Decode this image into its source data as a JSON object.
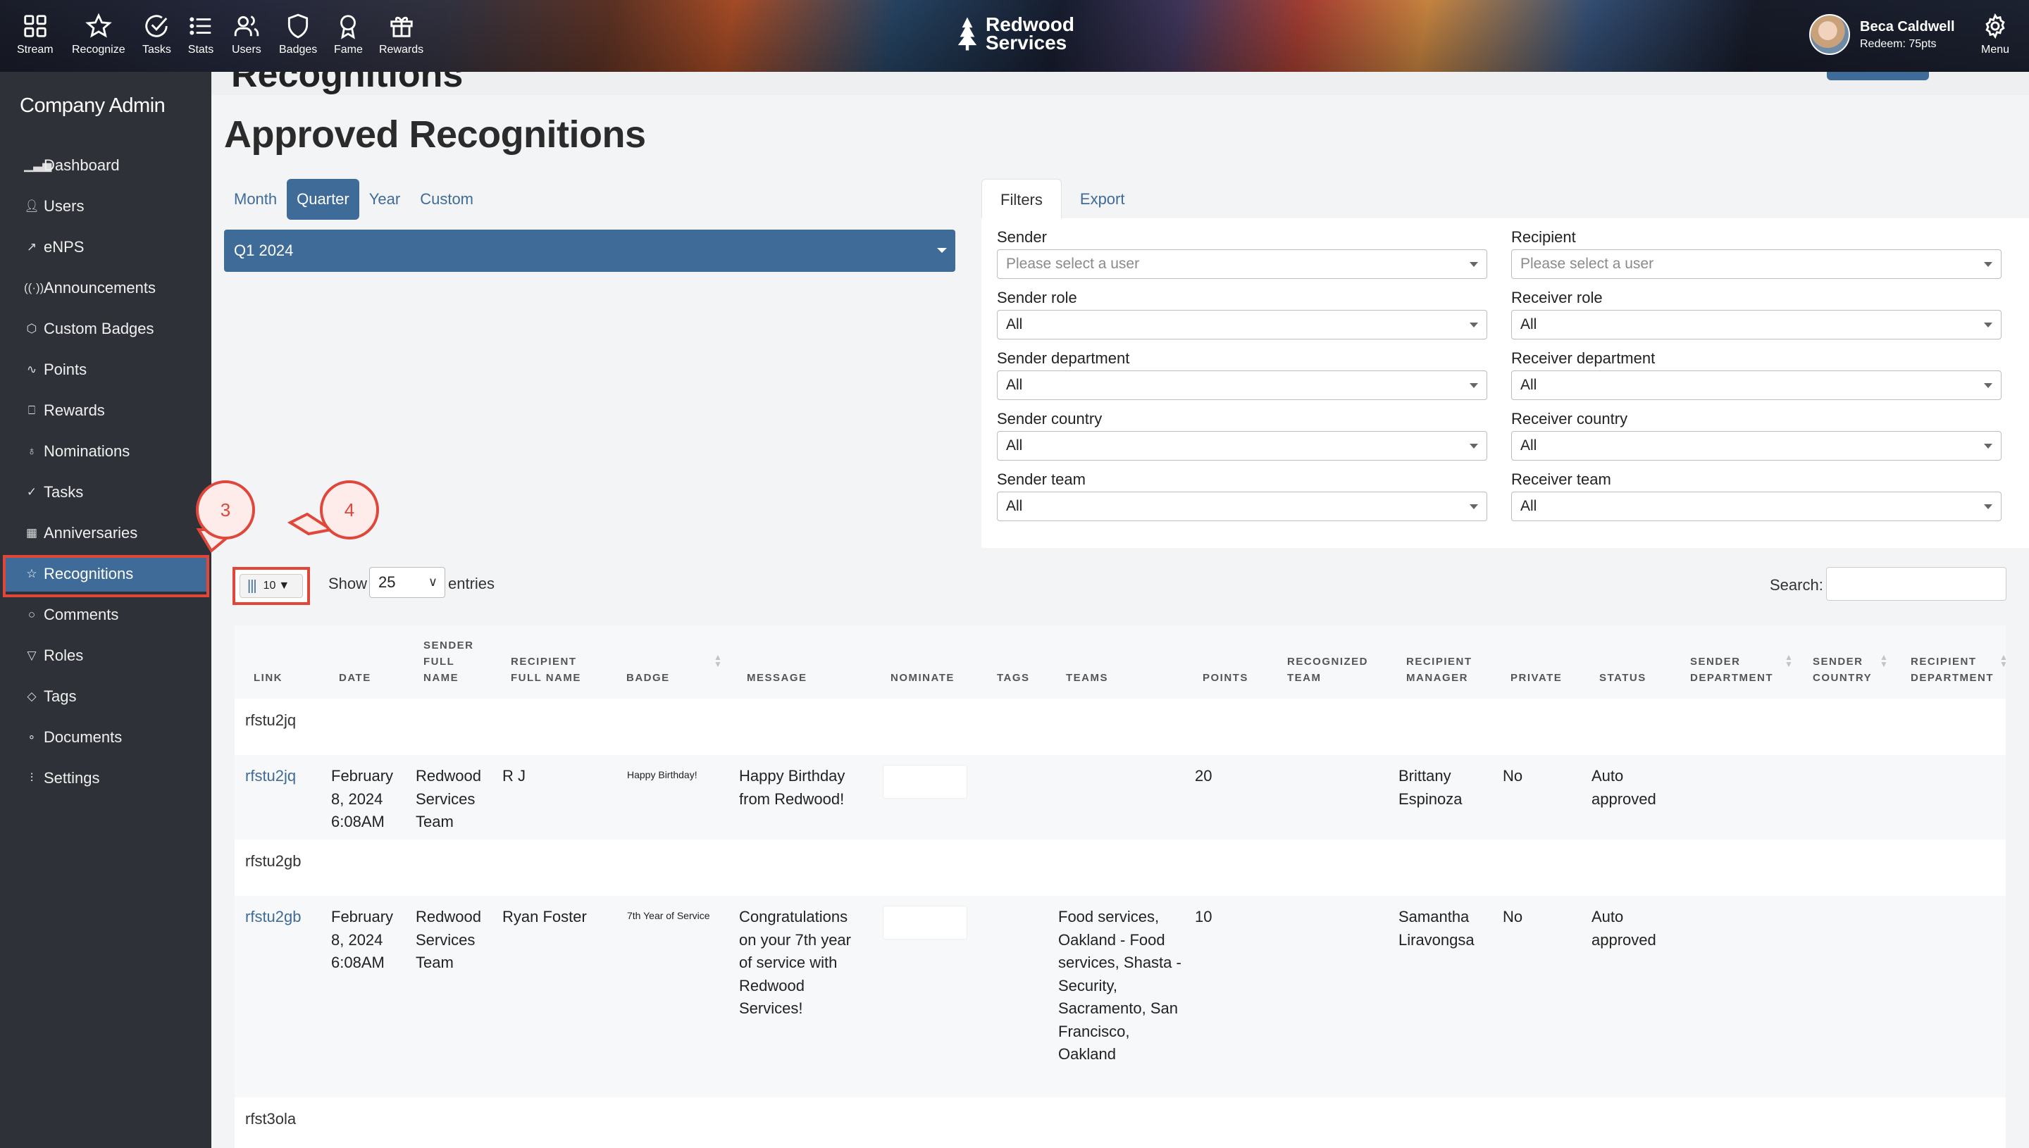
{
  "topnav": {
    "items": [
      {
        "label": "Stream",
        "icon": "grid-icon"
      },
      {
        "label": "Recognize",
        "icon": "star-icon"
      },
      {
        "label": "Tasks",
        "icon": "check-circle-icon"
      },
      {
        "label": "Stats",
        "icon": "list-icon"
      },
      {
        "label": "Users",
        "icon": "users-icon"
      },
      {
        "label": "Badges",
        "icon": "shield-icon"
      },
      {
        "label": "Fame",
        "icon": "award-icon"
      },
      {
        "label": "Rewards",
        "icon": "gift-icon"
      }
    ],
    "brand_line1": "Redwood",
    "brand_line2": "Services",
    "user_name": "Beca Caldwell",
    "user_sub": "Redeem: 75pts",
    "menu_label": "Menu"
  },
  "sidebar": {
    "title": "Company Admin",
    "items": [
      {
        "label": "Dashboard",
        "icon": "bar-chart-icon"
      },
      {
        "label": "Users",
        "icon": "user-icon"
      },
      {
        "label": "eNPS",
        "icon": "trend-icon"
      },
      {
        "label": "Announcements",
        "icon": "broadcast-icon"
      },
      {
        "label": "Custom Badges",
        "icon": "shield-icon"
      },
      {
        "label": "Points",
        "icon": "pulse-icon"
      },
      {
        "label": "Rewards",
        "icon": "gift-icon"
      },
      {
        "label": "Nominations",
        "icon": "award-icon"
      },
      {
        "label": "Tasks",
        "icon": "check-circle-icon"
      },
      {
        "label": "Anniversaries",
        "icon": "calendar-icon"
      },
      {
        "label": "Recognitions",
        "icon": "star-icon"
      },
      {
        "label": "Comments",
        "icon": "comment-icon"
      },
      {
        "label": "Roles",
        "icon": "filter-icon"
      },
      {
        "label": "Tags",
        "icon": "tag-icon"
      },
      {
        "label": "Documents",
        "icon": "paperclip-icon"
      },
      {
        "label": "Settings",
        "icon": "sliders-icon"
      }
    ],
    "active": "Recognitions"
  },
  "main": {
    "strip_title": "Recognitions",
    "title": "Approved Recognitions",
    "period_tabs": [
      "Month",
      "Quarter",
      "Year",
      "Custom"
    ],
    "active_period": "Quarter",
    "selected_quarter": "Q1 2024"
  },
  "filters": {
    "tabs": [
      "Filters",
      "Export"
    ],
    "active_tab": "Filters",
    "fields": [
      {
        "label": "Sender",
        "value": "Please select a user",
        "placeholder": true
      },
      {
        "label": "Recipient",
        "value": "Please select a user",
        "placeholder": true
      },
      {
        "label": "Sender role",
        "value": "All"
      },
      {
        "label": "Receiver role",
        "value": "All"
      },
      {
        "label": "Sender department",
        "value": "All"
      },
      {
        "label": "Receiver department",
        "value": "All"
      },
      {
        "label": "Sender country",
        "value": "All"
      },
      {
        "label": "Receiver country",
        "value": "All"
      },
      {
        "label": "Sender team",
        "value": "All"
      },
      {
        "label": "Receiver team",
        "value": "All"
      }
    ]
  },
  "table_controls": {
    "columns_count": "10",
    "show_label": "Show",
    "show_value": "25",
    "entries_label": "entries",
    "search_label": "Search:"
  },
  "table": {
    "columns": [
      "Link",
      "Date",
      "Sender Full Name",
      "Recipient Full Name",
      "Badge",
      "Message",
      "Nominate",
      "Tags",
      "Teams",
      "Points",
      "Recognized Team",
      "Recipient Manager",
      "Private",
      "Status",
      "Sender Department",
      "Sender Country",
      "Recipient Department"
    ],
    "groups": [
      {
        "group": "rfstu2jq",
        "link": "rfstu2jq",
        "date": "February 8, 2024 6:08AM",
        "sender": "Redwood Services Team",
        "recipient": "R J",
        "badge": "Happy Birthday!",
        "message": "Happy Birthday from Redwood!",
        "teams": "",
        "points": "20",
        "manager": "Brittany Espinoza",
        "private": "No",
        "status": "Auto approved"
      },
      {
        "group": "rfstu2gb",
        "link": "rfstu2gb",
        "date": "February 8, 2024 6:08AM",
        "sender": "Redwood Services Team",
        "recipient": "Ryan Foster",
        "badge": "7th Year of Service",
        "message": "Congratulations on your 7th year of service with Redwood Services!",
        "teams": "Food services, Oakland - Food services, Shasta - Security, Sacramento, San Francisco, Oakland",
        "points": "10",
        "manager": "Samantha Liravongsa",
        "private": "No",
        "status": "Auto approved"
      }
    ],
    "trailing_group": "rfst3ola"
  },
  "annotations": {
    "callout_a": "3",
    "callout_b": "4"
  },
  "colors": {
    "accent": "#3f6b98",
    "sidebar": "#2f3138",
    "annotation": "#e0463a"
  }
}
